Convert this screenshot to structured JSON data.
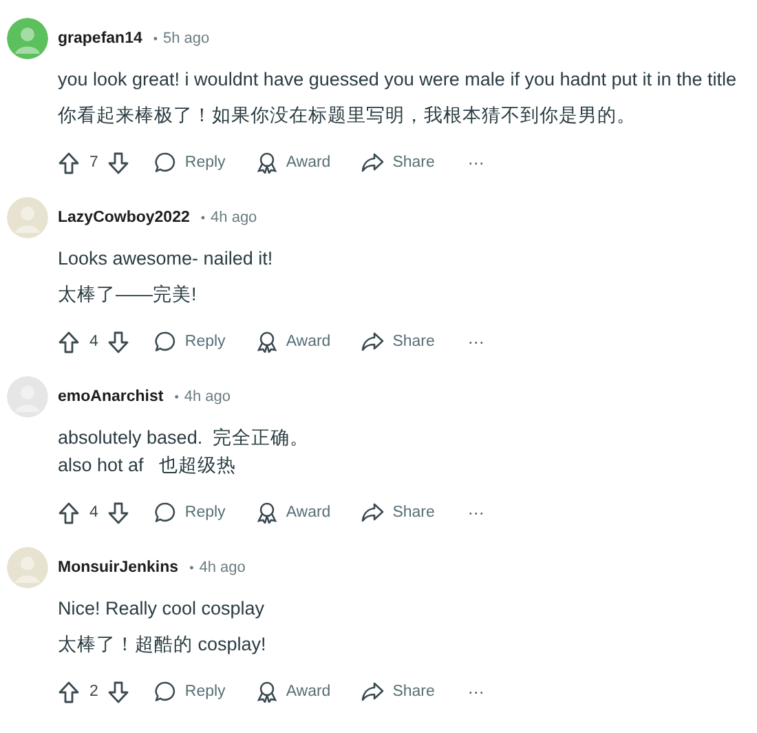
{
  "comments": [
    {
      "author": "grapefan14",
      "separator": "•",
      "time": "5h ago",
      "color": "#5cc05c",
      "paragraphs": [
        "you look great! i wouldnt have guessed you were male if you hadnt put it in the title",
        "你看起来棒极了！如果你没在标题里写明，我根本猜不到你是男的。"
      ],
      "votes": "7",
      "actions": [
        "Reply",
        "Award",
        "Share"
      ],
      "more": "···"
    },
    {
      "author": "LazyCowboy2022",
      "separator": "•",
      "time": "4h ago",
      "color": "#e8e3d0",
      "paragraphs": [
        "Looks awesome- nailed it!",
        "太棒了——完美!"
      ],
      "votes": "4",
      "actions": [
        "Reply",
        "Award",
        "Share"
      ],
      "more": "···"
    },
    {
      "author": "emoAnarchist",
      "separator": "•",
      "time": "4h ago",
      "color": "#e6e6e6",
      "paragraphs": [
        "absolutely based.  完全正确。\nalso hot af   也超级热"
      ],
      "votes": "4",
      "actions": [
        "Reply",
        "Award",
        "Share"
      ],
      "more": "···"
    },
    {
      "author": "MonsuirJenkins",
      "separator": "•",
      "time": "4h ago",
      "color": "#e8e3d0",
      "paragraphs": [
        "Nice! Really cool cosplay",
        "太棒了！超酷的 cosplay!"
      ],
      "votes": "2",
      "actions": [
        "Reply",
        "Award",
        "Share"
      ],
      "more": "···"
    }
  ]
}
